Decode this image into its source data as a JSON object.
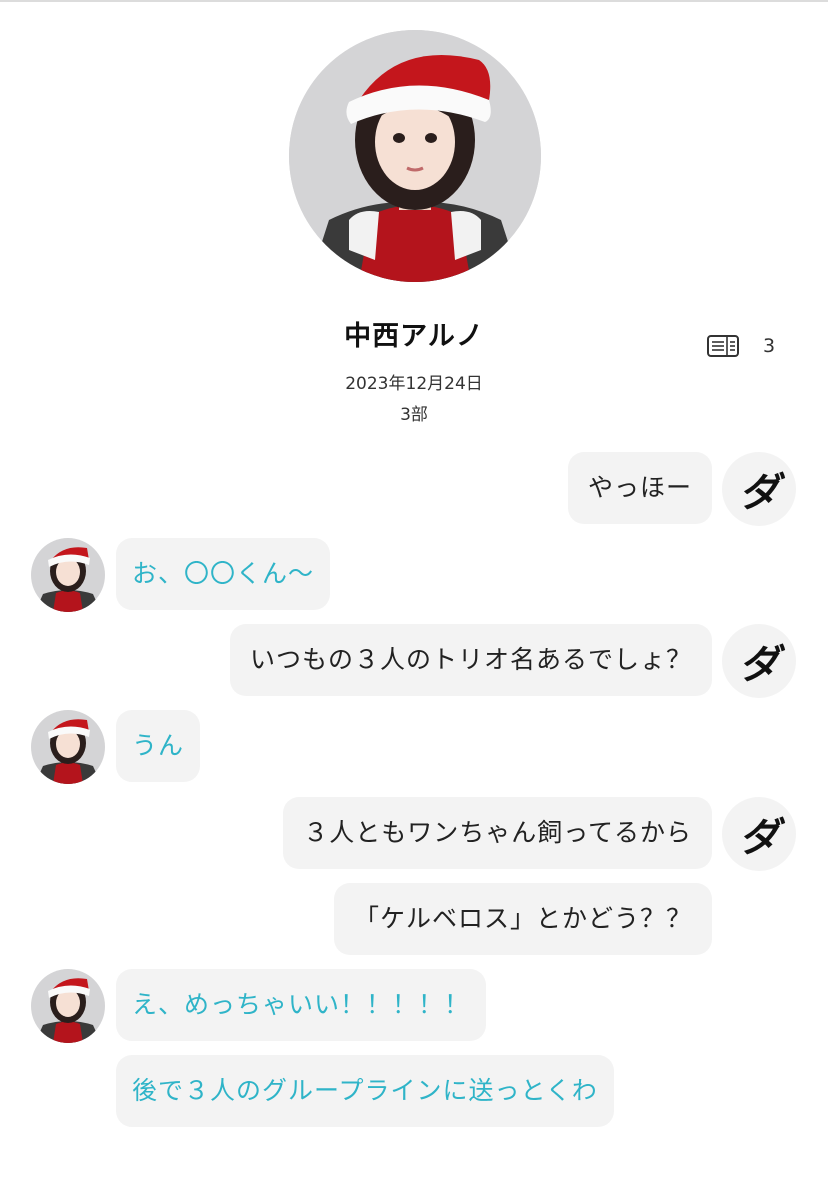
{
  "profile": {
    "name": "中西アルノ",
    "date": "2023年12月24日",
    "part": "3部",
    "letter_count": "3",
    "letter_icon": "letter-book-icon"
  },
  "me_avatar_text": "ダ",
  "messages": [
    {
      "sender": "me",
      "text": "やっほー"
    },
    {
      "sender": "her",
      "text": "お、〇〇くん〜"
    },
    {
      "sender": "me",
      "text": "いつもの３人のトリオ名あるでしょ？"
    },
    {
      "sender": "her",
      "text": "うん"
    },
    {
      "sender": "me",
      "text": "３人ともワンちゃん飼ってるから"
    },
    {
      "sender": "me",
      "text": "「ケルベロス」とかどう？？"
    },
    {
      "sender": "her",
      "text": "え、めっちゃいい！！！！！"
    },
    {
      "sender": "her",
      "text": "後で３人のグループラインに送っとくわ"
    }
  ],
  "colors": {
    "bubble_bg": "#f3f3f3",
    "her_text": "#2fb4c8",
    "me_text": "#222222"
  }
}
